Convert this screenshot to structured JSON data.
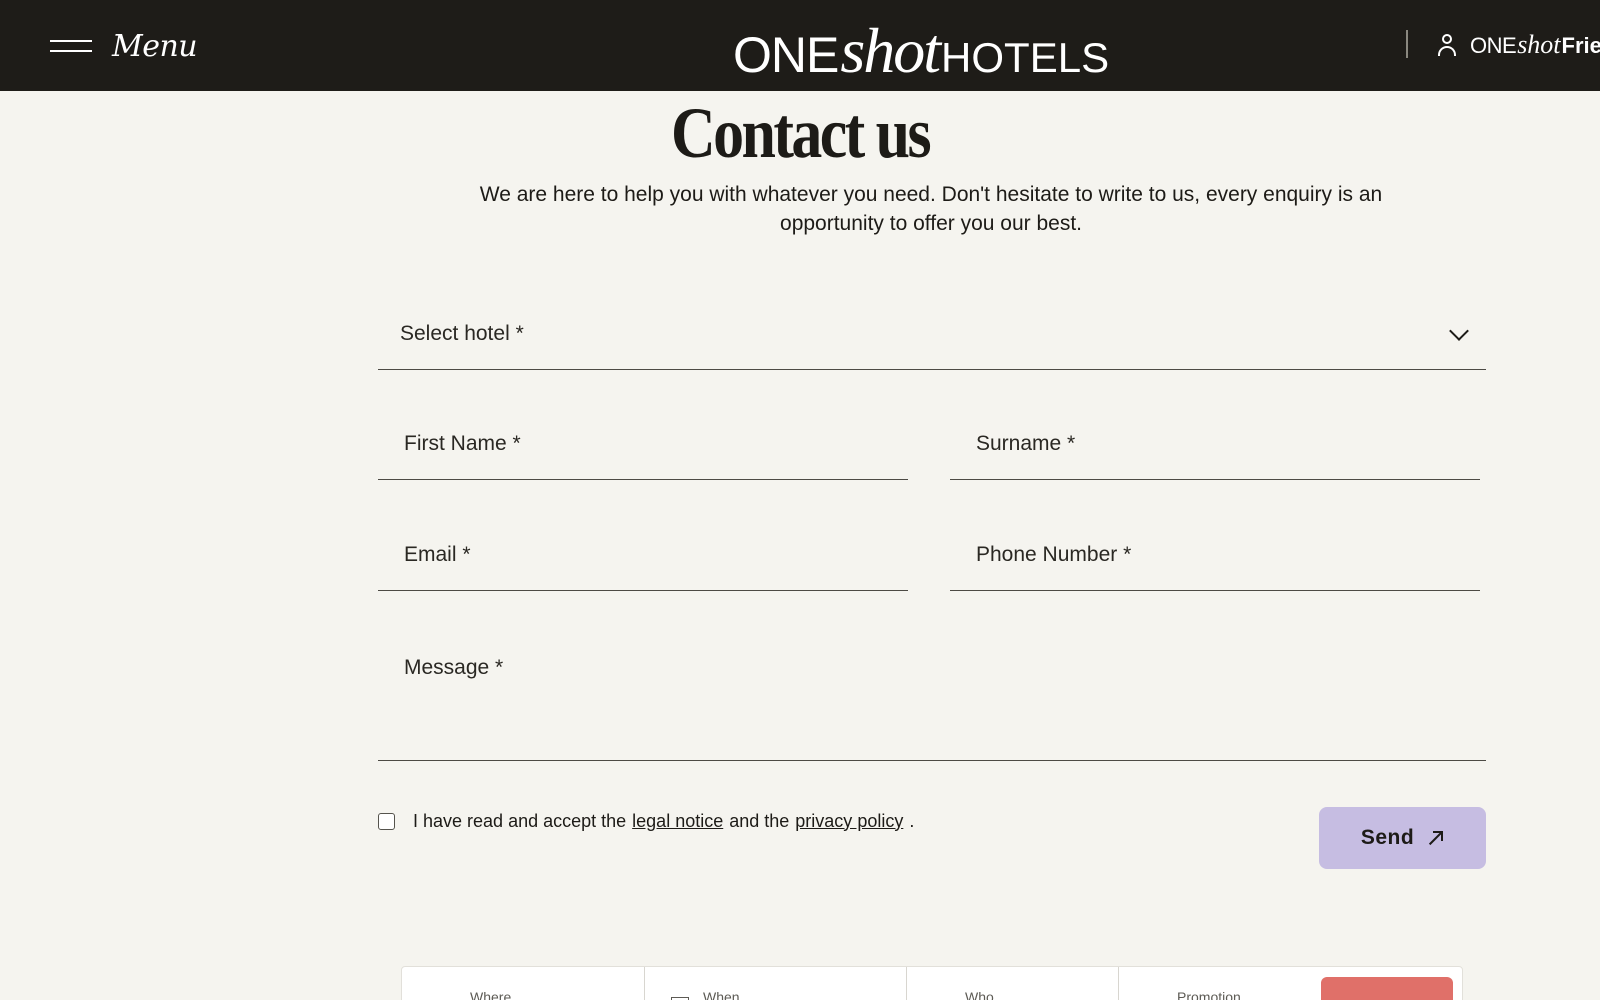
{
  "header": {
    "menu_label": "Menu",
    "logo": {
      "one": "ONE",
      "shot": "shot",
      "hotels": "HOTELS"
    },
    "account": {
      "one": "ONE",
      "shot": "shot",
      "friends": "Frie"
    }
  },
  "page": {
    "title": "Contact us",
    "intro": "We are here to help you with whatever you need. Don't hesitate to write to us, every enquiry is an opportunity to offer you our best."
  },
  "form": {
    "select_hotel": "Select hotel *",
    "first_name": "First Name *",
    "surname": "Surname *",
    "email": "Email *",
    "phone": "Phone Number *",
    "message": "Message *",
    "consent_prefix": "I have read and accept the",
    "legal_notice": "legal notice",
    "consent_middle": "and the",
    "privacy_policy": "privacy policy",
    "consent_suffix": ".",
    "send": "Send"
  },
  "booking": {
    "where": "Where",
    "when": "When",
    "who": "Who",
    "promotion": "Promotion"
  },
  "colors": {
    "header_bg": "#1e1c18",
    "page_bg": "#f5f4ef",
    "send_button": "#c6bde2",
    "book_button": "#e07069"
  }
}
